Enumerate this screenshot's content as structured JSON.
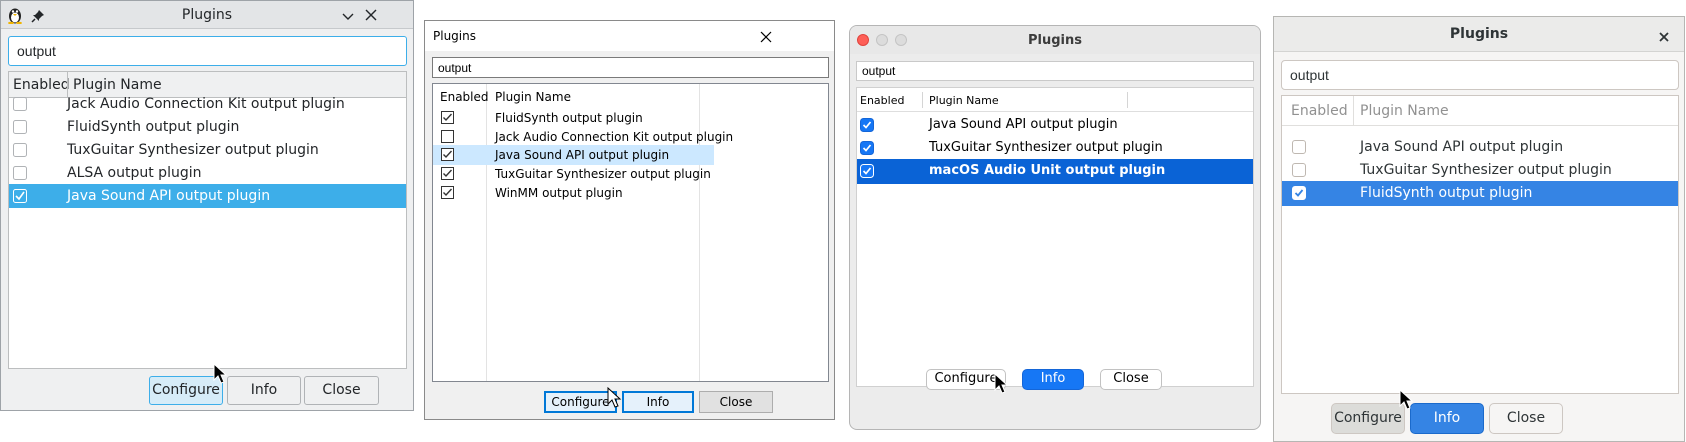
{
  "windows": [
    {
      "title": "Plugins",
      "search": {
        "value": "output"
      },
      "header": {
        "enabled": "Enabled",
        "name": "Plugin Name"
      },
      "rows": [
        {
          "name": "Jack Audio Connection Kit output plugin",
          "checked": false,
          "selected": false
        },
        {
          "name": "FluidSynth output plugin",
          "checked": false,
          "selected": false
        },
        {
          "name": "TuxGuitar Synthesizer output plugin",
          "checked": false,
          "selected": false
        },
        {
          "name": "ALSA output plugin",
          "checked": false,
          "selected": false
        },
        {
          "name": "Java Sound API output plugin",
          "checked": true,
          "selected": true
        }
      ],
      "buttons": {
        "configure": "Configure",
        "info": "Info",
        "close": "Close"
      }
    },
    {
      "title": "Plugins",
      "search": {
        "value": "output"
      },
      "header": {
        "enabled": "Enabled",
        "name": "Plugin Name"
      },
      "rows": [
        {
          "name": "FluidSynth output plugin",
          "checked": true,
          "selected": false
        },
        {
          "name": "Jack Audio Connection Kit output plugin",
          "checked": false,
          "selected": false
        },
        {
          "name": "Java Sound API output plugin",
          "checked": true,
          "selected": true
        },
        {
          "name": "TuxGuitar Synthesizer output plugin",
          "checked": true,
          "selected": false
        },
        {
          "name": "WinMM output plugin",
          "checked": true,
          "selected": false
        }
      ],
      "buttons": {
        "configure": "Configure",
        "info": "Info",
        "close": "Close"
      }
    },
    {
      "title": "Plugins",
      "search": {
        "value": "output"
      },
      "header": {
        "enabled": "Enabled",
        "name": "Plugin Name"
      },
      "rows": [
        {
          "name": "Java Sound API output plugin",
          "checked": true,
          "selected": false
        },
        {
          "name": "TuxGuitar Synthesizer output plugin",
          "checked": true,
          "selected": false
        },
        {
          "name": "macOS Audio Unit output plugin",
          "checked": true,
          "selected": true
        }
      ],
      "buttons": {
        "configure": "Configure",
        "info": "Info",
        "close": "Close"
      }
    },
    {
      "title": "Plugins",
      "search": {
        "value": "output"
      },
      "header": {
        "enabled": "Enabled",
        "name": "Plugin Name"
      },
      "rows": [
        {
          "name": "Java Sound API output plugin",
          "checked": false,
          "selected": false
        },
        {
          "name": "TuxGuitar Synthesizer output plugin",
          "checked": false,
          "selected": false
        },
        {
          "name": "FluidSynth output plugin",
          "checked": true,
          "selected": true
        }
      ],
      "buttons": {
        "configure": "Configure",
        "info": "Info",
        "close": "Close"
      }
    }
  ],
  "colors": {
    "kde_accent": "#3daee9",
    "windows_selection": "#cce8ff",
    "windows_focus": "#0078d7",
    "mac_selection": "#0a63d6",
    "mac_primary": "#1677f5",
    "gnome_accent": "#3584e4"
  },
  "icons": {
    "w1_titlebar": [
      "app-tux-icon",
      "pin-icon",
      "chevron-down-icon",
      "close-icon"
    ],
    "w2_titlebar": [
      "close-icon"
    ],
    "w3_titlebar": [
      "close-light-icon",
      "minimize-light-icon",
      "zoom-light-icon"
    ],
    "w4_titlebar": [
      "close-icon"
    ],
    "cursor": "mouse-pointer-icon"
  }
}
